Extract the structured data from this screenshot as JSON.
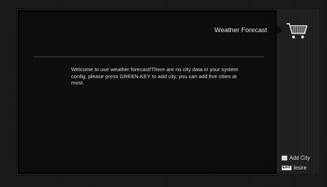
{
  "header": {
    "title": "Weather Forecast"
  },
  "message": {
    "text": "Welcome to use weather forecast!There are no city data in your system config, please press GREEN KEY to add city, you can add five cities at most."
  },
  "legend": {
    "add_city": {
      "label": "Add City",
      "icon": "square-key-icon"
    },
    "exit": {
      "key_text": "EXIT",
      "label": "lesire"
    }
  },
  "icons": {
    "cart": "shopping-cart-icon"
  }
}
